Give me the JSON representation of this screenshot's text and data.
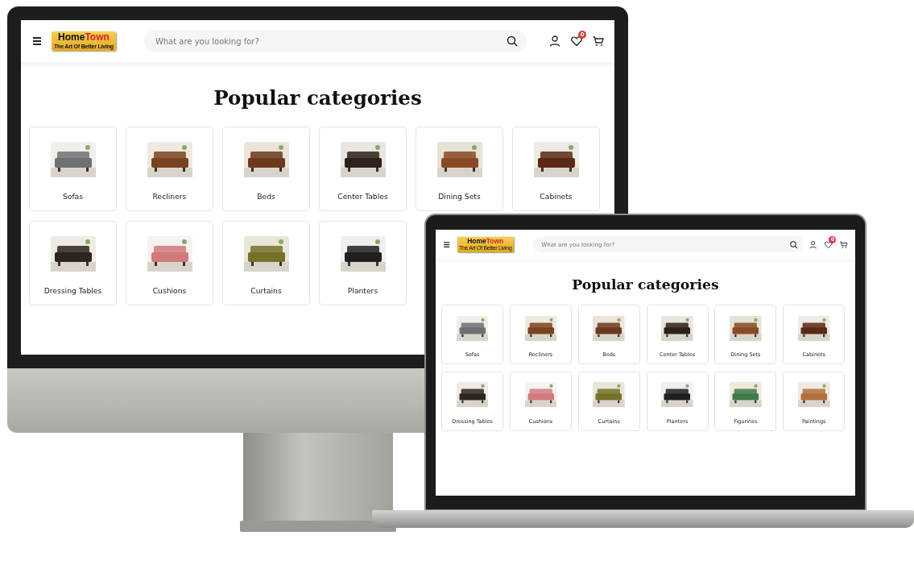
{
  "desktop": {
    "header": {
      "logo": {
        "name_first": "Home",
        "name_second": "Town",
        "tagline": "The Art Of Better Living"
      },
      "search": {
        "placeholder": "What are you looking for?"
      },
      "wishlist_count": "0"
    },
    "title": "Popular categories",
    "categories": [
      {
        "label": "Sofas"
      },
      {
        "label": "Recliners"
      },
      {
        "label": "Beds"
      },
      {
        "label": "Center Tables"
      },
      {
        "label": "Dining Sets"
      },
      {
        "label": "Cabinets"
      },
      {
        "label": "Dressing Tables"
      },
      {
        "label": "Cushions"
      },
      {
        "label": "Curtains"
      },
      {
        "label": "Planters"
      }
    ]
  },
  "laptop": {
    "header": {
      "logo": {
        "name_first": "Home",
        "name_second": "Town",
        "tagline": "The Art Of Better Living"
      },
      "search": {
        "placeholder": "What are you looking for?"
      },
      "wishlist_count": "0"
    },
    "title": "Popular categories",
    "categories": [
      {
        "label": "Sofas"
      },
      {
        "label": "Recliners"
      },
      {
        "label": "Beds"
      },
      {
        "label": "Center Tables"
      },
      {
        "label": "Dining Sets"
      },
      {
        "label": "Cabinets"
      },
      {
        "label": "Dressing Tables"
      },
      {
        "label": "Cushions"
      },
      {
        "label": "Curtains"
      },
      {
        "label": "Planters"
      },
      {
        "label": "Figurines"
      },
      {
        "label": "Paintings"
      }
    ]
  }
}
